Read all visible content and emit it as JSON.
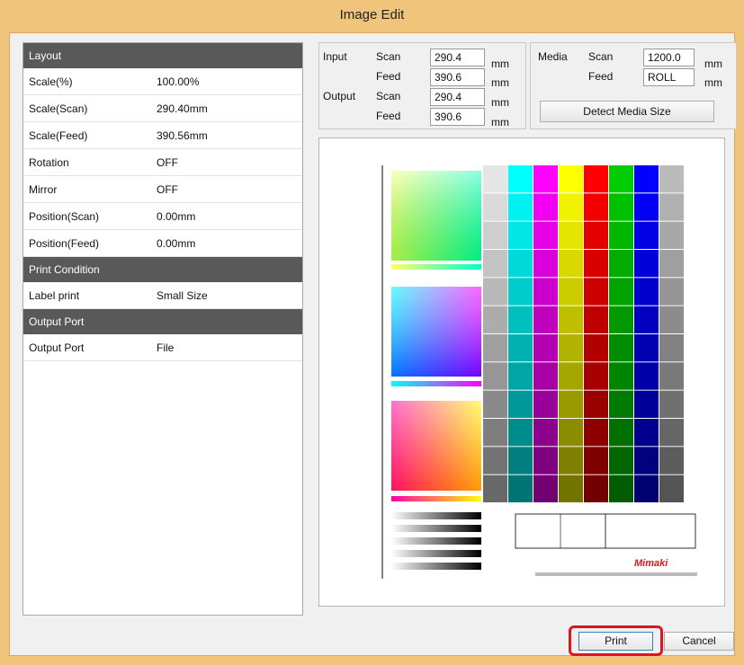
{
  "window": {
    "title": "Image Edit"
  },
  "panel": {
    "sections": [
      {
        "header": "Layout",
        "rows": [
          {
            "key": "Scale(%)",
            "value": "100.00%"
          },
          {
            "key": "Scale(Scan)",
            "value": "290.40mm"
          },
          {
            "key": "Scale(Feed)",
            "value": "390.56mm"
          },
          {
            "key": "Rotation",
            "value": "OFF"
          },
          {
            "key": "Mirror",
            "value": "OFF"
          },
          {
            "key": "Position(Scan)",
            "value": "0.00mm"
          },
          {
            "key": "Position(Feed)",
            "value": "0.00mm"
          }
        ]
      },
      {
        "header": "Print Condition",
        "rows": [
          {
            "key": "Label print",
            "value": "Small Size"
          }
        ]
      },
      {
        "header": "Output Port",
        "rows": [
          {
            "key": "Output Port",
            "value": "File"
          }
        ]
      }
    ]
  },
  "size": {
    "input_label": "Input",
    "output_label": "Output",
    "scan_label": "Scan",
    "feed_label": "Feed",
    "unit": "mm",
    "input_scan": "290.4",
    "input_feed": "390.6",
    "output_scan": "290.4",
    "output_feed": "390.6"
  },
  "media": {
    "label": "Media",
    "scan_label": "Scan",
    "feed_label": "Feed",
    "unit": "mm",
    "scan": "1200.0",
    "feed": "ROLL",
    "detect_label": "Detect Media Size"
  },
  "preview": {
    "brand": "Mimaki",
    "bar_colors": [
      "#e6e6e6",
      "#00ffff",
      "#ff00ff",
      "#ffff00",
      "#ff0000",
      "#00cc00",
      "#0000ff",
      "#bbbbbb"
    ]
  },
  "buttons": {
    "print": "Print",
    "cancel": "Cancel"
  },
  "colors": {
    "title_bar": "#f0c47a",
    "section_header": "#595959",
    "highlight": "#e0141e"
  }
}
